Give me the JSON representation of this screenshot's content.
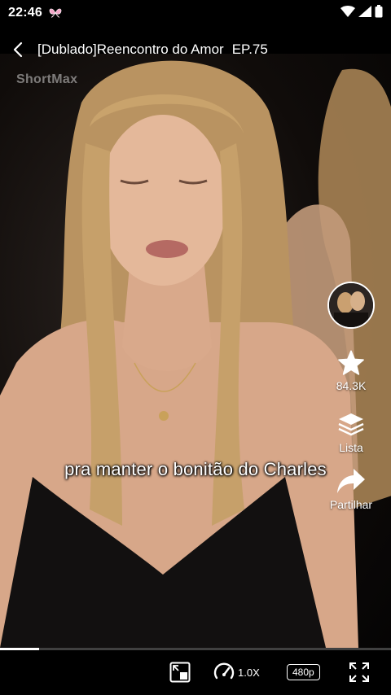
{
  "status_bar": {
    "time": "22:46"
  },
  "header": {
    "title": "[Dublado]Reencontro do Amor",
    "episode": "EP.75"
  },
  "watermark": "ShortMax",
  "rail": {
    "favorite_count": "84.3K",
    "list_label": "Lista",
    "share_label": "Partilhar"
  },
  "subtitle": "pra manter o bonitão do Charles",
  "progress": {
    "fraction": 0.1
  },
  "controls": {
    "speed_label": "1.0X",
    "quality_label": "480p"
  },
  "icons": {
    "back": "chevron-left-icon",
    "favorite": "star-icon",
    "list": "stack-icon",
    "share": "share-arrow-icon",
    "pip": "picture-in-picture-icon",
    "speed": "speedometer-icon",
    "fullscreen": "fullscreen-icon"
  }
}
